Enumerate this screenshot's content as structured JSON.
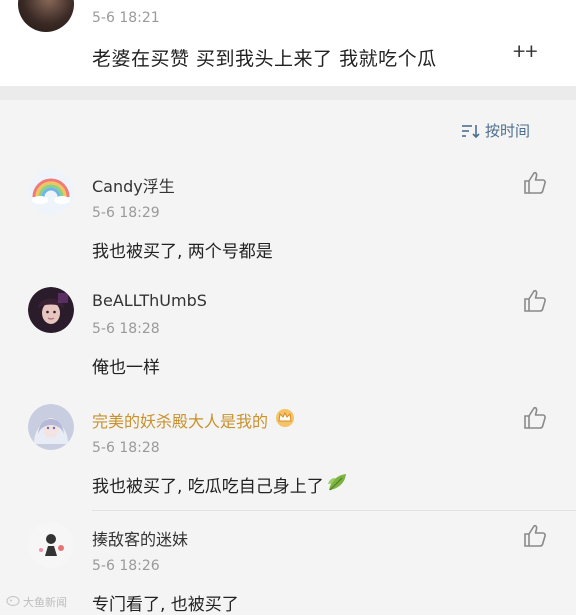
{
  "top_comment": {
    "time": "5-6 18:21",
    "text": "老婆在买赞 买到我头上来了 我就吃个瓜",
    "emoji": " ⵜⵜ"
  },
  "sort": {
    "label": "按时间",
    "icon": "sort-icon"
  },
  "comments": [
    {
      "username": "Candy浮生",
      "time": "5-6 18:29",
      "text": "我也被买了, 两个号都是",
      "avatar": "rainbow-avatar"
    },
    {
      "username": "BeALLThUmbS",
      "time": "5-6 18:28",
      "text": "俺也一样",
      "avatar": "girl-avatar"
    },
    {
      "username": "完美的妖杀殿大人是我的",
      "time": "5-6 18:28",
      "text": "我也被买了, 吃瓜吃自己身上了",
      "avatar": "anime-avatar",
      "username_color": "#c9922c",
      "badge": "crown-badge",
      "suffix_icon": "leaf-emoji"
    },
    {
      "username": "揍敌客的迷妹",
      "time": "5-6 18:26",
      "text": "专门看了, 也被买了",
      "avatar": "doodle-avatar"
    }
  ],
  "watermark": {
    "text": "大鱼新闻"
  }
}
